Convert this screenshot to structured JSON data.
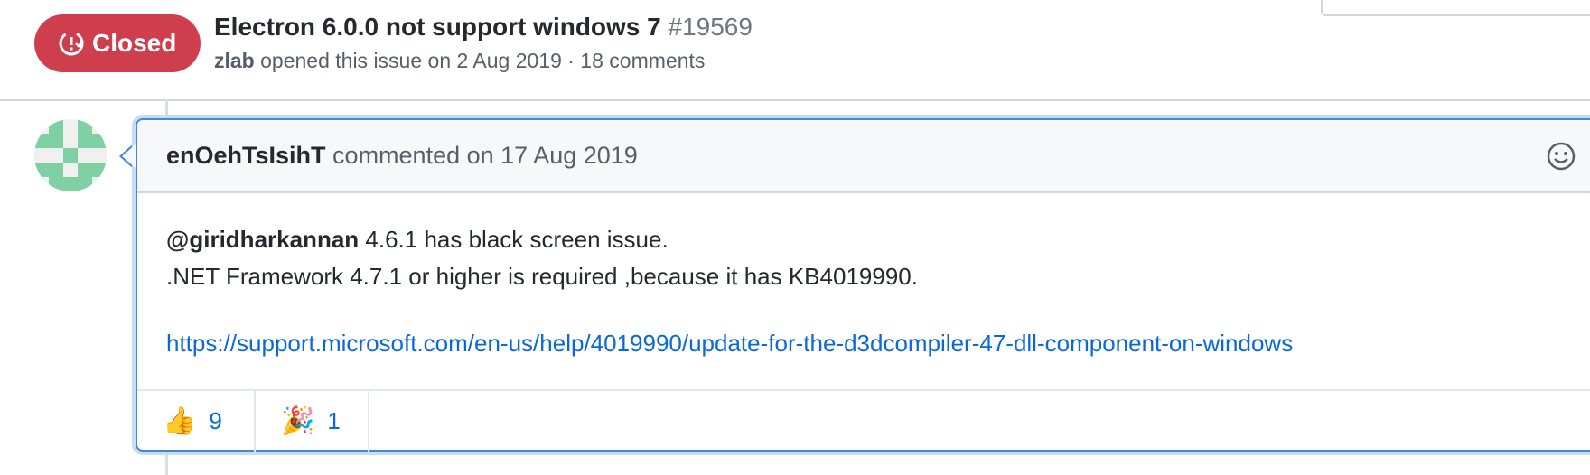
{
  "issue": {
    "status": "Closed",
    "title": "Electron 6.0.0 not support windows 7",
    "number": "#19569",
    "author": "zlab",
    "opened_text": "opened this issue on 2 Aug 2019 · 18 comments",
    "status_color": "#cf3e4d"
  },
  "comment": {
    "author": "enOehTsIsihT",
    "date_text": "commented on 17 Aug 2019",
    "mention": "@giridharkannan",
    "line1_rest": " 4.6.1 has black screen issue.",
    "line2": ".NET Framework 4.7.1 or higher is required ,because it has KB4019990.",
    "link": "https://support.microsoft.com/en-us/help/4019990/update-for-the-d3dcompiler-47-dll-component-on-windows",
    "reactions": [
      {
        "icon": "thumbs-up-icon",
        "emoji": "👍",
        "count": "9"
      },
      {
        "icon": "party-popper-icon",
        "emoji": "🎉",
        "count": "1"
      }
    ],
    "accent_color": "#4389d6",
    "link_color": "#0a69da"
  }
}
